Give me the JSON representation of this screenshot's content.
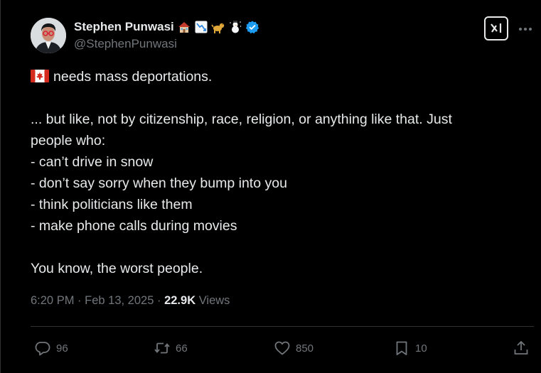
{
  "author": {
    "name": "Stephen Punwasi",
    "handle": "@StephenPunwasi",
    "name_emojis": [
      "house-emoji",
      "chart-decreasing-emoji",
      "dog-emoji",
      "snowman-emoji"
    ],
    "verified": true
  },
  "tweet": {
    "lines": [
      "needs mass deportations.",
      "",
      "... but like, not by citizenship, race, religion, or anything like that. Just",
      "people who:",
      "- can’t drive in snow",
      "- don’t say sorry when they bump into you",
      "- think politicians like them",
      "- make phone calls during movies",
      "",
      "You know, the worst people."
    ],
    "leading_emoji": "canada-flag-emoji"
  },
  "meta": {
    "time": "6:20 PM",
    "separator": "·",
    "date": "Feb 13, 2025",
    "views_count": "22.9K",
    "views_label": "Views"
  },
  "actions": {
    "replies": "96",
    "reposts": "66",
    "likes": "850",
    "bookmarks": "10"
  },
  "colors": {
    "background": "#000000",
    "text": "#e7e9ea",
    "secondary": "#71767b",
    "verified": "#1d9bf0",
    "divider": "#2f3336"
  }
}
